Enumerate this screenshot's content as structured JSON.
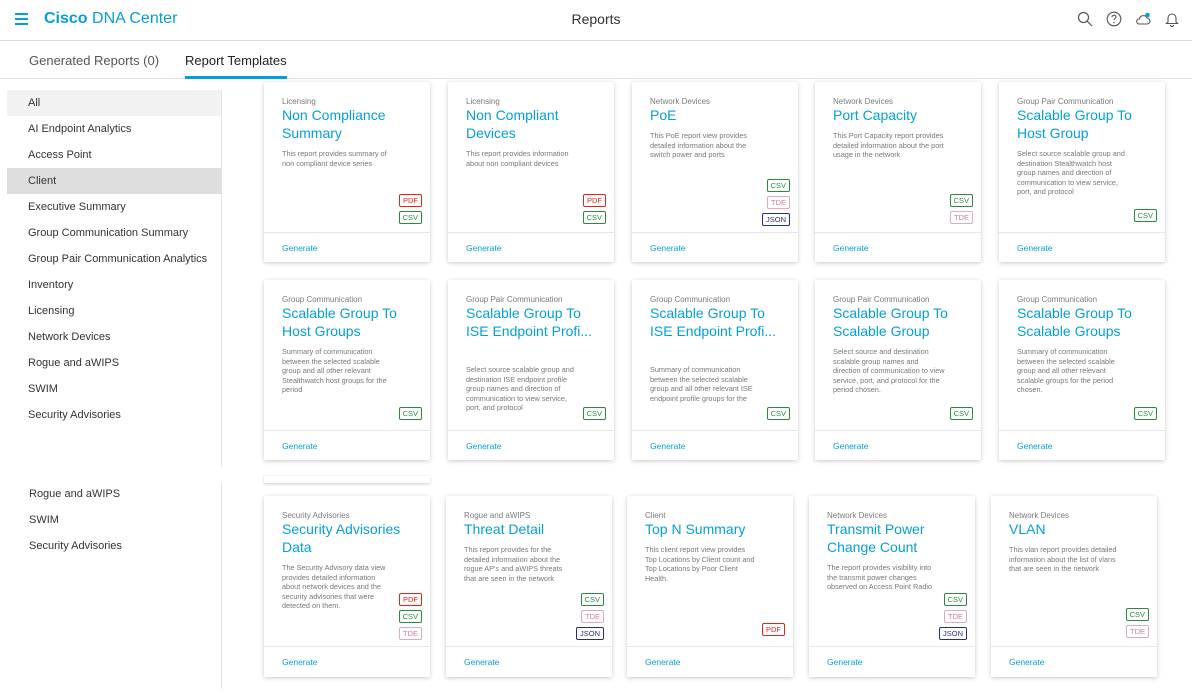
{
  "header": {
    "brand_bold": "Cisco",
    "brand_rest": " DNA Center",
    "title": "Reports",
    "icons": [
      "search-icon",
      "help-icon",
      "cloud-notification-icon",
      "bell-icon"
    ]
  },
  "tabs": [
    {
      "label": "Generated Reports (0)"
    },
    {
      "label": "Report Templates",
      "active": true
    }
  ],
  "sidebar": {
    "items": [
      "All",
      "AI Endpoint Analytics",
      "Access Point",
      "Client",
      "Executive Summary",
      "Group Communication Summary",
      "Group Pair Communication Analytics",
      "Inventory",
      "Licensing",
      "Network Devices",
      "Rogue and aWIPS",
      "SWIM",
      "Security Advisories"
    ],
    "selected": "Client",
    "items_lower": [
      "Rogue and aWIPS",
      "SWIM",
      "Security Advisories"
    ]
  },
  "generate_label": "Generate",
  "colors": {
    "accent": "#049fd9",
    "pdf": "#e2231a",
    "csv": "#2b8a3e",
    "tde": "#d679a8",
    "json": "#262d87"
  },
  "cards": [
    {
      "category": "Licensing",
      "title": "Non Compliance Summary",
      "desc": "This report provides summary of non compliant device series",
      "formats": [
        "PDF",
        "CSV"
      ]
    },
    {
      "category": "Licensing",
      "title": "Non Compliant Devices",
      "desc": "This report provides information about non compliant devices",
      "formats": [
        "PDF",
        "CSV"
      ]
    },
    {
      "category": "Network Devices",
      "title": "PoE",
      "desc": "This PoE report view provides detailed information about the switch power and ports",
      "formats": [
        "CSV",
        "TDE",
        "JSON"
      ]
    },
    {
      "category": "Network Devices",
      "title": "Port Capacity",
      "desc": "This Port Capacity report provides detailed information about the port usage in the network",
      "formats": [
        "CSV",
        "TDE"
      ]
    },
    {
      "category": "Group Pair Communication",
      "title": "Scalable Group To Host Group",
      "desc": "Select source scalable group and destination Stealthwatch host group names and direction of communication to view service, port, and protocol",
      "formats": [
        "CSV"
      ]
    },
    {
      "category": "Group Communication",
      "title": "Scalable Group To Host Groups",
      "desc": "Summary of communication between the selected scalable group and all other relevant Stealthwatch host groups for the period",
      "formats": [
        "CSV"
      ]
    },
    {
      "category": "Group Pair Communication",
      "title": "Scalable Group To ISE Endpoint Profi...",
      "desc": "Select source scalable group and destination ISE endpoint profile group names and direction of communication to view service, port, and protocol",
      "formats": [
        "CSV"
      ]
    },
    {
      "category": "Group Communication",
      "title": "Scalable Group To ISE Endpoint Profi...",
      "desc": "Summary of communication between the selected scalable group and all other relevant ISE endpoint profile groups for the",
      "formats": [
        "CSV"
      ]
    },
    {
      "category": "Group Pair Communication",
      "title": "Scalable Group To Scalable Group",
      "desc": "Select source and destination scalable group names and direction of communication to view service, port, and protocol for the period chosen.",
      "formats": [
        "CSV"
      ]
    },
    {
      "category": "Group Communication",
      "title": "Scalable Group To Scalable Groups",
      "desc": "Summary of communication between the selected scalable group and all other relevant scalable groups for the period chosen.",
      "formats": [
        "CSV"
      ]
    },
    {
      "category": "Security Advisories",
      "title": "Security Advisories Data",
      "desc": "The Security Advisory data view provides detailed information about network devices and the security advisories that were detected on them.",
      "formats": [
        "PDF",
        "CSV",
        "TDE"
      ]
    },
    {
      "category": "Rogue and aWIPS",
      "title": "Threat Detail",
      "desc": "This report provides for the detailed information about the rogue AP's and aWIPS threats that are seen in the network",
      "formats": [
        "CSV",
        "TDE",
        "JSON"
      ]
    },
    {
      "category": "Client",
      "title": "Top N Summary",
      "desc": "This client report view provides Top Locations by Client count and Top Locations by Poor Client Health.",
      "formats": [
        "PDF"
      ]
    },
    {
      "category": "Network Devices",
      "title": "Transmit Power Change Count",
      "desc": "The report provides visibility into the transmit power changes observed on Access Point Radio",
      "formats": [
        "CSV",
        "TDE",
        "JSON"
      ]
    },
    {
      "category": "Network Devices",
      "title": "VLAN",
      "desc": "This vlan report provides detailed information about the list of vlans that are seen in the network",
      "formats": [
        "CSV",
        "TDE"
      ]
    }
  ]
}
